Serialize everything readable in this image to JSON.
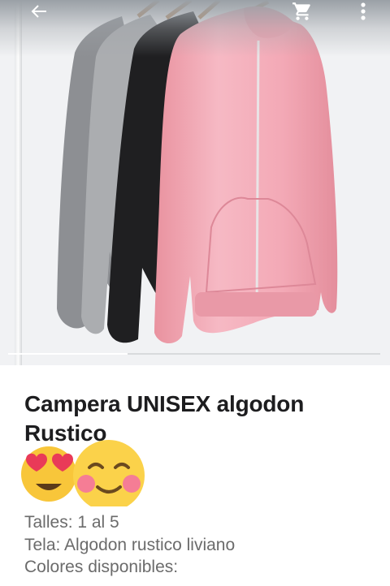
{
  "product": {
    "title": "Campera UNISEX algodon Rustico",
    "image": {
      "description_icon": "hanging-jackets-photo",
      "colors": [
        "#8e9094",
        "#a9abae",
        "#1e1e20",
        "#f2aab8"
      ]
    },
    "gallery": {
      "current": 1,
      "progress_fraction": 0.32
    },
    "details": {
      "sizes": "Talles: 1 al 5",
      "fabric": "Tela: Algodon rustico liviano",
      "colors_label": "Colores disponibles:"
    }
  },
  "toolbar": {
    "back_icon": "back-arrow-icon",
    "cart_icon": "shopping-cart-icon",
    "more_icon": "more-vert-icon"
  },
  "stickers": [
    "heart-eyes-emoji",
    "smiling-blush-emoji"
  ]
}
